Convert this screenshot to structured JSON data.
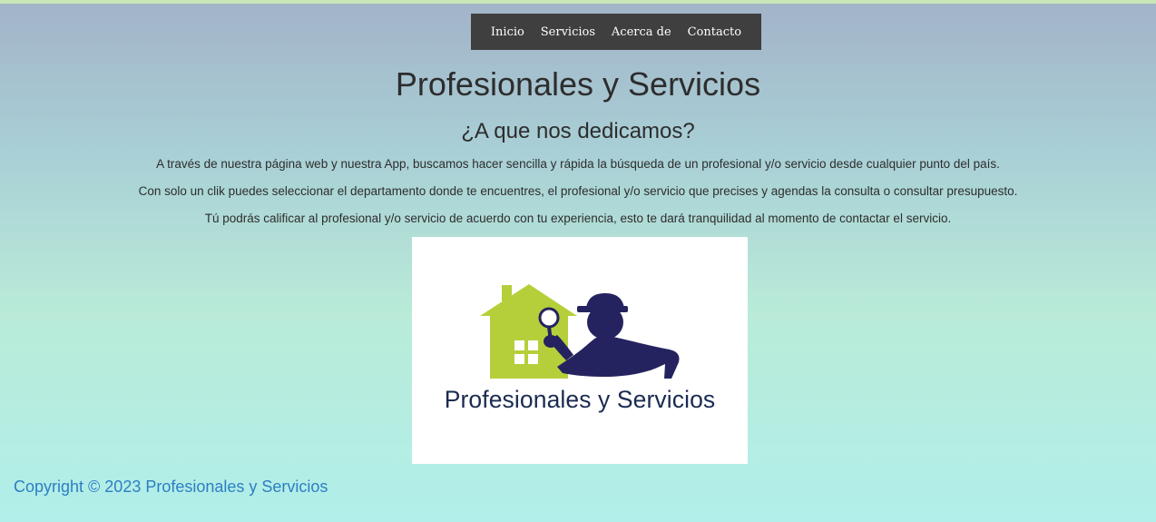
{
  "nav": {
    "items": [
      {
        "label": "Inicio"
      },
      {
        "label": "Servicios"
      },
      {
        "label": "Acerca de"
      },
      {
        "label": "Contacto"
      }
    ]
  },
  "main": {
    "title": "Profesionales y Servicios",
    "subtitle": "¿A que nos dedicamos?",
    "paragraphs": [
      "A través de nuestra página web y nuestra App, buscamos hacer sencilla y rápida la búsqueda de un profesional y/o servicio desde cualquier punto del país.",
      "Con solo un clik puedes seleccionar el departamento donde te encuentres, el profesional y/o servicio que precises y agendas la consulta o consultar presupuesto.",
      "Tú podrás calificar al profesional y/o servicio de acuerdo con tu experiencia, esto te dará tranquilidad al momento de contactar el servicio."
    ],
    "logo": {
      "text": "Profesionales y Servicios",
      "icon": "house-detective-magnifier-logo",
      "colors": {
        "house": "#b5cf3a",
        "detective": "#24235f",
        "text": "#1a2b52"
      }
    }
  },
  "footer": {
    "copyright": "Copyright © 2023 Profesionales y Servicios"
  },
  "colors": {
    "navbar": "#3f3f3f",
    "copyright_link": "#2e7ec4",
    "background_top": "#a2b3c8",
    "background_bottom": "#b1efea"
  }
}
